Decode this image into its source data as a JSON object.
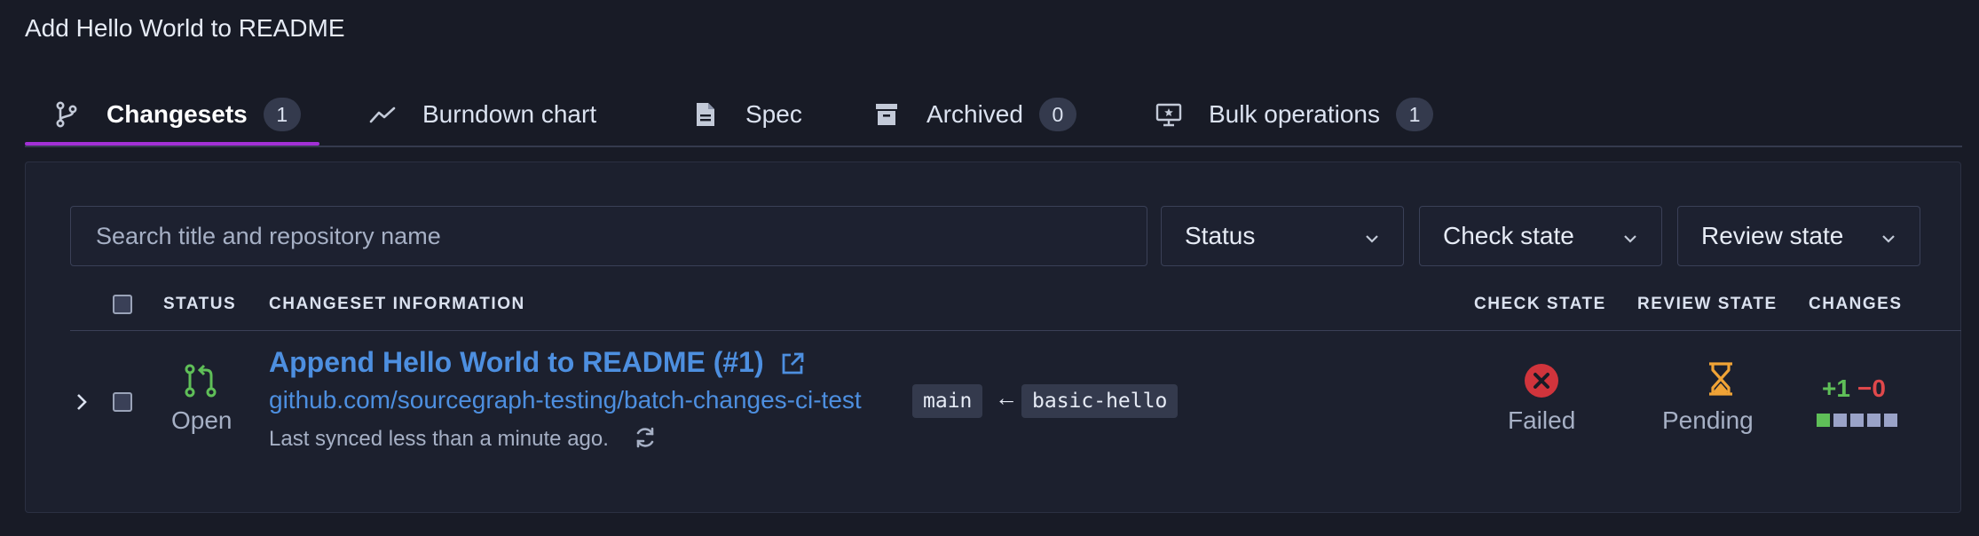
{
  "page": {
    "title": "Add Hello World to README"
  },
  "tabs": [
    {
      "label": "Changesets",
      "badge": "1",
      "icon": "branch-icon",
      "active": true
    },
    {
      "label": "Burndown chart",
      "icon": "chart-line-icon"
    },
    {
      "label": "Spec",
      "icon": "file-icon"
    },
    {
      "label": "Archived",
      "badge": "0",
      "icon": "archive-icon"
    },
    {
      "label": "Bulk operations",
      "badge": "1",
      "icon": "monitor-star-icon"
    }
  ],
  "filters": {
    "search_placeholder": "Search title and repository name",
    "status_label": "Status",
    "check_state_label": "Check state",
    "review_state_label": "Review state"
  },
  "table": {
    "headers": {
      "status": "STATUS",
      "changeset_info": "CHANGESET INFORMATION",
      "check_state": "CHECK STATE",
      "review_state": "REVIEW STATE",
      "changes": "CHANGES"
    },
    "rows": [
      {
        "status": "Open",
        "title": "Append Hello World to README (#1)",
        "repo": "github.com/sourcegraph-testing/batch-changes-ci-test",
        "base_branch": "main",
        "arrow": "←",
        "head_branch": "basic-hello",
        "synced": "Last synced less than a minute ago.",
        "check_state": "Failed",
        "review_state": "Pending",
        "added": "+1",
        "removed": "−0",
        "diff_blocks": {
          "added": 1,
          "unchanged": 4
        }
      }
    ]
  },
  "colors": {
    "accent": "#a230d6",
    "link": "#4d8fe0",
    "open": "#5fbf58",
    "failed": "#d0343c",
    "pending": "#f0a336",
    "added": "#5fbf58",
    "removed": "#e0484b",
    "unchanged_block": "#9aa3c8"
  }
}
